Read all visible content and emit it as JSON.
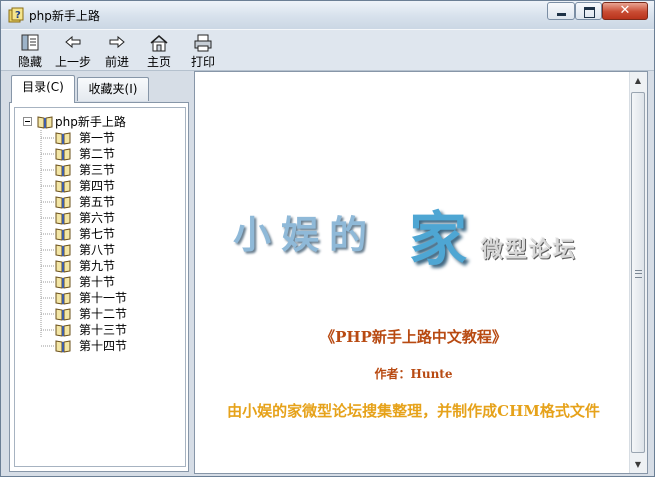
{
  "window": {
    "title": "php新手上路",
    "icon": "help-file-icon",
    "controls": {
      "minimize": "minimize-icon",
      "maximize": "maximize-icon",
      "close": "✕"
    }
  },
  "toolbar": {
    "buttons": [
      {
        "label": "隐藏",
        "icon": "hide-pane-icon"
      },
      {
        "label": "上一步",
        "icon": "back-arrow-icon"
      },
      {
        "label": "前进",
        "icon": "forward-arrow-icon"
      },
      {
        "label": "主页",
        "icon": "home-icon"
      },
      {
        "label": "打印",
        "icon": "printer-icon"
      }
    ]
  },
  "navigation": {
    "tabs": [
      {
        "label": "目录(C)",
        "selected": true
      },
      {
        "label": "收藏夹(I)",
        "selected": false
      }
    ],
    "tree": {
      "root": {
        "label": "php新手上路",
        "expanded": true,
        "expander": "−"
      },
      "items": [
        "第一节",
        "第二节",
        "第三节",
        "第四节",
        "第五节",
        "第六节",
        "第七节",
        "第八节",
        "第九节",
        "第十节",
        "第十一节",
        "第十二节",
        "第十三节",
        "第十四节"
      ]
    }
  },
  "content": {
    "logo": {
      "main": "小娱的",
      "emphasis": "家",
      "sub": "微型论坛"
    },
    "title": "《PHP新手上路中文教程》",
    "author": "作者：Hunte",
    "description": "由小娱的家微型论坛搜集整理，并制作成CHM格式文件"
  },
  "colors": {
    "title_text": "#b84a12",
    "description_text": "#e6a21a",
    "logo_blue": "#4ea6d3",
    "close_button": "#c94c33"
  },
  "scrollbar": {
    "up": "▲",
    "down": "▼"
  }
}
